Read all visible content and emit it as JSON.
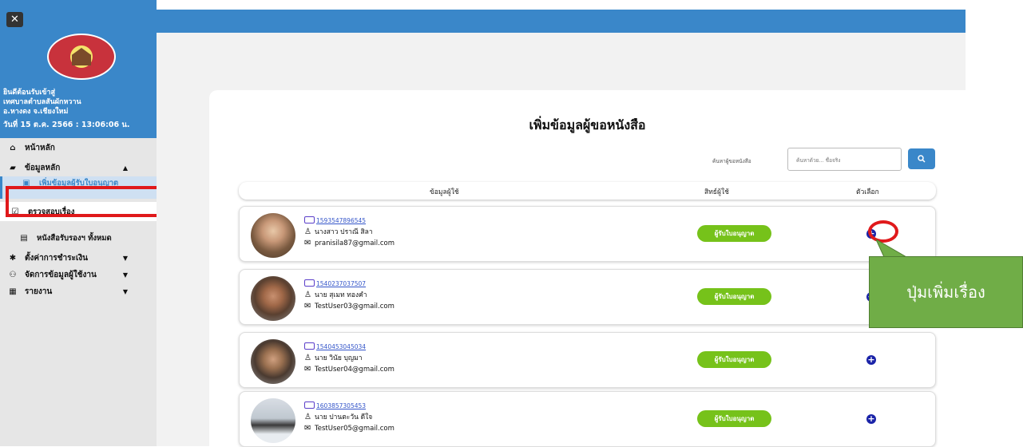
{
  "sidebar": {
    "close_glyph": "✕",
    "welcome_line1": "ยินดีต้อนรับเข้าสู่",
    "welcome_line2": "เทศบาลตำบลสันผักหวาน",
    "welcome_line3": "อ.หางดง จ.เชียงใหม่",
    "datetime": "วันที่ 15 ต.ค. 2566 : 13:06:06 น.",
    "items": [
      {
        "label": "หน้าหลัก",
        "icon": "home-icon"
      },
      {
        "label": "ข้อมูลหลัก",
        "icon": "database-icon"
      },
      {
        "label": "เพิ่มข้อมูลผู้รับใบอนุญาต",
        "icon": "user-add-icon"
      },
      {
        "label": "ตรวจสอบเรื่อง",
        "icon": "checkbox-icon"
      },
      {
        "label": "หนังสือรับรองฯ ทั้งหมด",
        "icon": "document-icon"
      },
      {
        "label": "ตั้งค่าการชำระเงิน",
        "icon": "gear-icon"
      },
      {
        "label": "จัดการข้อมูลผู้ใช้งาน",
        "icon": "users-icon"
      },
      {
        "label": "รายงาน",
        "icon": "chart-icon"
      }
    ]
  },
  "main": {
    "title": "เพิ่มข้อมูลผู้ขอหนังสือ",
    "search": {
      "label": "ค้นหาผู้ขอหนังสือ",
      "placeholder": "ค้นหาด้วย... ชื่อจริง"
    },
    "columns": [
      "ข้อมูลผู้ใช้",
      "สิทธ์ผู้ใช้",
      "ตัวเลือก"
    ],
    "rows": [
      {
        "id": "1593547896545",
        "name": "นางสาว ปราณี สิลา",
        "email": "pranisila87@gmail.com",
        "role": "ผู้รับใบอนุญาต"
      },
      {
        "id": "1540237037507",
        "name": "นาย สุเมท ทองคำ",
        "email": "TestUser03@gmail.com",
        "role": "ผู้รับใบอนุญาต"
      },
      {
        "id": "1540453045034",
        "name": "นาย วินัย บุญมา",
        "email": "TestUser04@gmail.com",
        "role": "ผู้รับใบอนุญาต"
      },
      {
        "id": "1603857305453",
        "name": "นาย ปานตะวัน ดีใจ",
        "email": "TestUser05@gmail.com",
        "role": "ผู้รับใบอนุญาต"
      }
    ]
  },
  "annotation": {
    "callout_text": "ปุ่มเพิ่มเรื่อง"
  },
  "colors": {
    "primary": "#3a87c9",
    "role_badge": "#76c21a",
    "highlight": "#e0191b",
    "callout": "#70ad47"
  }
}
